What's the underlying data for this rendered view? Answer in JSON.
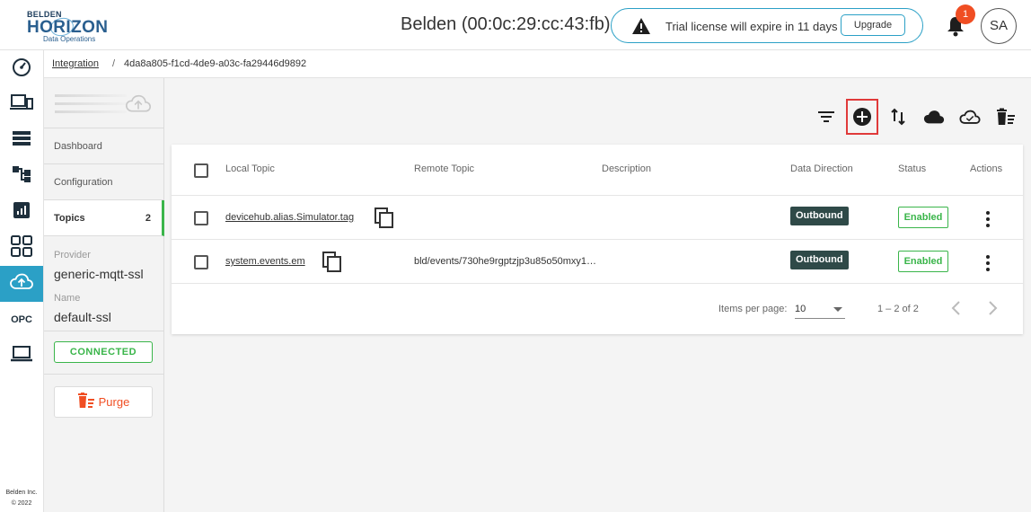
{
  "header": {
    "logo": {
      "line1": "BELDEN",
      "line2": "HORIZON",
      "line3": "Data Operations"
    },
    "device_title": "Belden (00:0c:29:cc:43:fb)",
    "license_message": "Trial license will expire in 11 days",
    "upgrade_label": "Upgrade",
    "notification_count": "1",
    "avatar_initials": "SA"
  },
  "leftnav": {
    "items": [
      "gauge-icon",
      "devices-icon",
      "list-icon",
      "hierarchy-icon",
      "chart-icon",
      "apps-grid-icon",
      "cloud-upload-icon",
      "OPC",
      "laptop-icon"
    ],
    "active_index": 6,
    "opc_label": "OPC",
    "copyright_line1": "Belden Inc.",
    "copyright_line2": "© 2022"
  },
  "breadcrumb": {
    "link": "Integration",
    "separator": "/",
    "current": "4da8a805-f1cd-4de9-a03c-fa29446d9892"
  },
  "sidebar": {
    "tabs": [
      {
        "label": "Dashboard"
      },
      {
        "label": "Configuration"
      },
      {
        "label": "Topics",
        "count": "2"
      }
    ],
    "provider_label": "Provider",
    "provider_value": "generic-mqtt-ssl",
    "name_label": "Name",
    "name_value": "default-ssl",
    "status": "CONNECTED",
    "purge_label": "Purge"
  },
  "toolbar": [
    "filter-icon",
    "add-circle-icon",
    "sort-icon",
    "cloud-icon",
    "cloud-outline-icon",
    "delete-list-icon"
  ],
  "table": {
    "columns": [
      "Local Topic",
      "Remote Topic",
      "Description",
      "Data Direction",
      "Status",
      "Actions"
    ],
    "rows": [
      {
        "local_topic": "devicehub.alias.Simulator.tag",
        "remote_topic": "",
        "description": "",
        "direction": "Outbound",
        "status": "Enabled"
      },
      {
        "local_topic": "system.events.em",
        "remote_topic": "bld/events/730he9rgptzjp3u85o50mxy1…",
        "description": "",
        "direction": "Outbound",
        "status": "Enabled"
      }
    ],
    "pagination": {
      "items_per_page_label": "Items per page:",
      "page_size": "10",
      "range": "1 – 2 of 2"
    }
  },
  "colors": {
    "accent": "#2ba0c6",
    "success": "#3ab54a",
    "danger": "#f04e23",
    "badge_dark": "#2f4a48",
    "highlight": "#e03a3a"
  }
}
